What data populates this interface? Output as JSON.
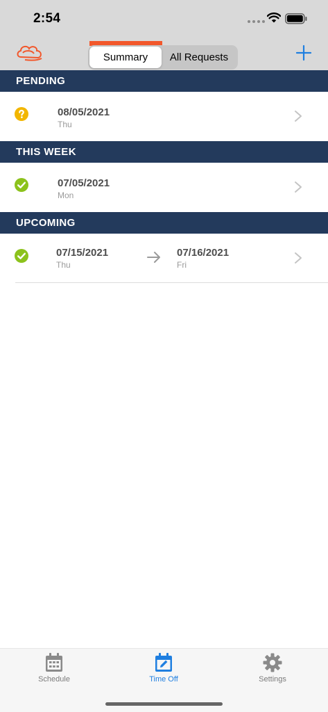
{
  "status_bar": {
    "time": "2:54"
  },
  "nav": {
    "segments": [
      {
        "label": "Summary",
        "active": true
      },
      {
        "label": "All Requests",
        "active": false
      }
    ],
    "accent_color": "#f2572b",
    "add_icon": "plus-icon"
  },
  "sections": [
    {
      "title": "PENDING",
      "rows": [
        {
          "status": "pending",
          "status_icon": "question-circle-icon",
          "start_date": "08/05/2021",
          "start_day": "Thu"
        }
      ]
    },
    {
      "title": "THIS WEEK",
      "rows": [
        {
          "status": "approved",
          "status_icon": "check-circle-icon",
          "start_date": "07/05/2021",
          "start_day": "Mon"
        }
      ]
    },
    {
      "title": "UPCOMING",
      "rows": [
        {
          "status": "approved",
          "status_icon": "check-circle-icon",
          "start_date": "07/15/2021",
          "start_day": "Thu",
          "end_date": "07/16/2021",
          "end_day": "Fri"
        }
      ]
    }
  ],
  "tab_bar": {
    "tabs": [
      {
        "label": "Schedule",
        "icon": "calendar-grid-icon",
        "active": false
      },
      {
        "label": "Time Off",
        "icon": "calendar-edit-icon",
        "active": true
      },
      {
        "label": "Settings",
        "icon": "gear-icon",
        "active": false
      }
    ],
    "active_color": "#1f7fe0"
  },
  "colors": {
    "header_bg": "#233a5c",
    "pending": "#f2b600",
    "approved": "#8cc21c"
  }
}
